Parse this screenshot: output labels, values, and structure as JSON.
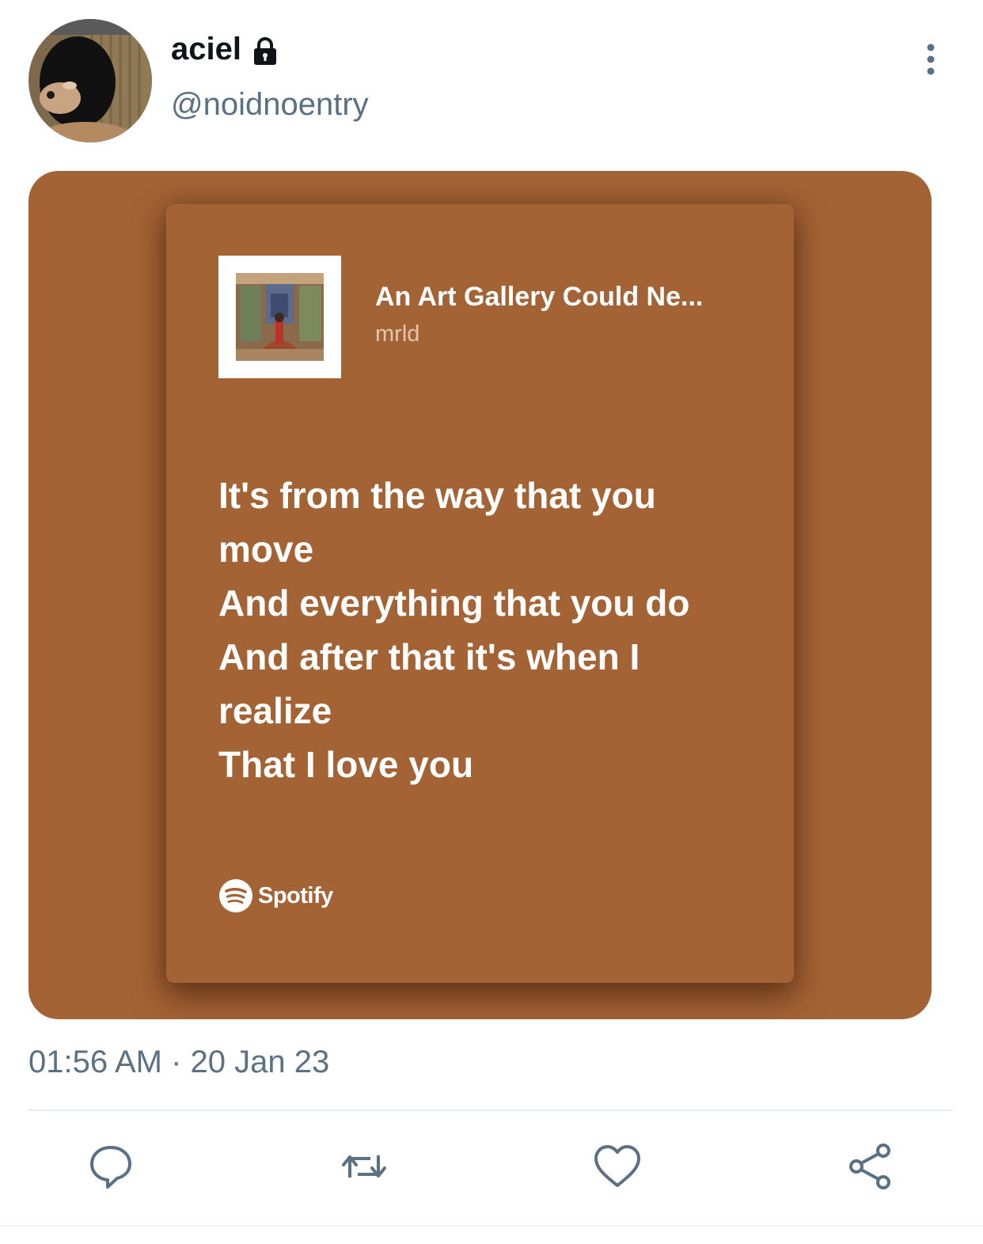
{
  "header": {
    "display_name": "aciel",
    "handle": "@noidnoentry",
    "protected_icon": "lock-icon",
    "more_icon": "more-vertical-icon"
  },
  "media": {
    "background_color": "#a46335",
    "card": {
      "song_title": "An Art Gallery Could Ne...",
      "artist": "mrld",
      "lyrics": [
        "It's from the way that you",
        "move",
        "And everything that you do",
        "And after that it's when I",
        "realize",
        "That I love you"
      ],
      "brand": "Spotify",
      "brand_icon": "spotify-icon"
    }
  },
  "timestamp": "01:56 AM · 20 Jan 23",
  "actions": [
    {
      "name": "reply",
      "icon": "reply-icon"
    },
    {
      "name": "retweet",
      "icon": "retweet-icon"
    },
    {
      "name": "like",
      "icon": "heart-icon"
    },
    {
      "name": "share",
      "icon": "share-icon"
    }
  ],
  "colors": {
    "text_primary": "#0f1419",
    "text_secondary": "#5b7083",
    "card_bg": "#a46335"
  }
}
